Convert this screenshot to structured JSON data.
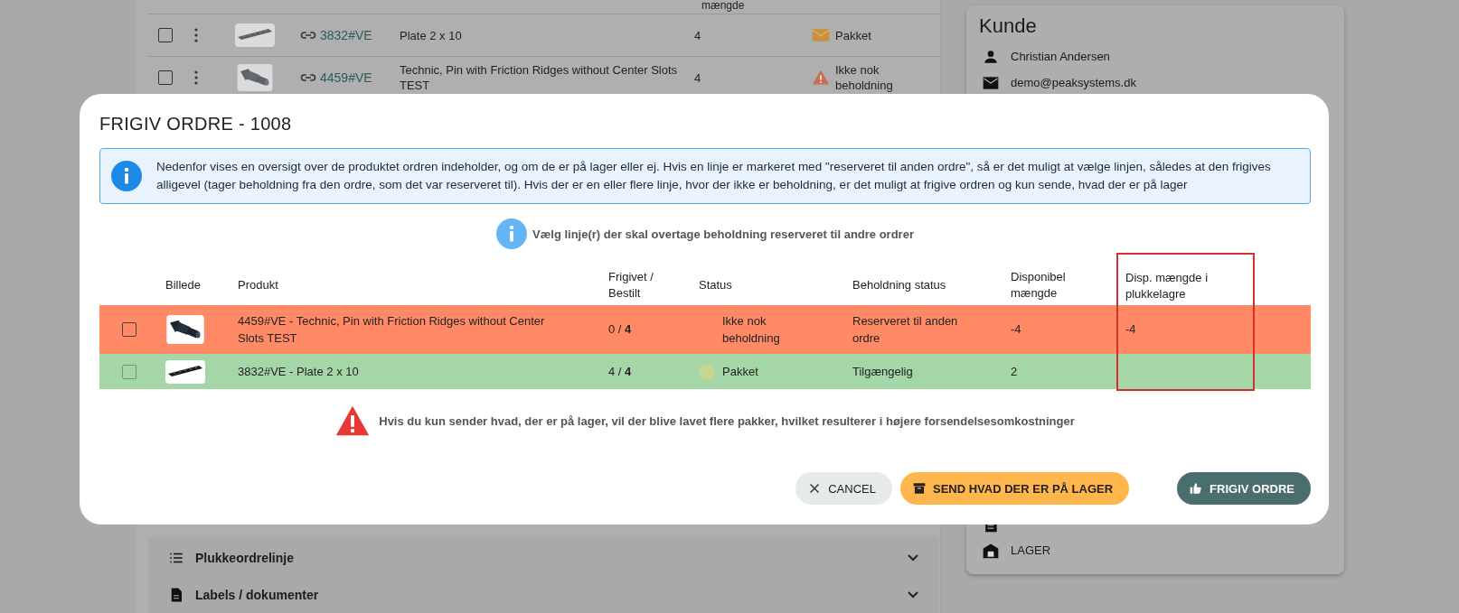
{
  "background": {
    "table": {
      "partial_header": "mængde",
      "rows": [
        {
          "checked": false,
          "link": "3832#VE",
          "product": "Plate 2 x 10",
          "quantity": "4",
          "status": "Pakket",
          "kind": "packed"
        },
        {
          "checked": false,
          "link": "4459#VE",
          "product": "Technic, Pin with Friction Ridges without Center Slots TEST",
          "quantity": "4",
          "status": "Ikke nok beholdning",
          "kind": "shortage"
        }
      ]
    },
    "accordions": [
      {
        "label": "Plukkeordrelinje",
        "expanded": false
      },
      {
        "label": "Labels / dokumenter",
        "expanded": false
      }
    ],
    "customer": {
      "title": "Kunde",
      "contact": [
        {
          "kind": "person",
          "text": "Christian Andersen"
        },
        {
          "kind": "email",
          "text": "demo@peaksystems.dk"
        }
      ],
      "details": [
        {
          "kind": "warehouse",
          "text": "LAGER"
        }
      ]
    }
  },
  "modal": {
    "title": "FRIGIV ORDRE - 1008",
    "info": "Nedenfor vises en oversigt over de produktet ordren indeholder, og om de er på lager eller ej. Hvis en linje er markeret med \"reserveret til anden ordre\", så er det muligt at vælge linjen, således at den frigives alligevel (tager beholdning fra den ordre, som det var reserveret til). Hvis der er en eller flere linje, hvor der ikke er beholdning, er det muligt at frigive ordren og kun sende, hvad der er på lager",
    "hint": "Vælg linje(r) der skal overtage beholdning reserveret til andre ordrer",
    "columns": [
      {
        "label": "Billede",
        "highlighted": false
      },
      {
        "label": "Produkt",
        "highlighted": false
      },
      {
        "label": "Frigivet / Bestilt",
        "highlighted": false
      },
      {
        "label": "Status",
        "highlighted": false
      },
      {
        "label": "Beholdning status",
        "highlighted": false
      },
      {
        "label": "Disponibel mængde",
        "highlighted": false
      },
      {
        "label": "Disp. mængde i plukkelagre",
        "highlighted": true
      }
    ],
    "rows": [
      {
        "checked": false,
        "disabled": false,
        "kind": "shortage",
        "product": "4459#VE - Technic, Pin with Friction Ridges without Center Slots TEST",
        "released": "0 / **4**",
        "status": "Ikke nok beholdning",
        "stock_status": "Reserveret til anden ordre",
        "available": "-4",
        "pick_available": "-4"
      },
      {
        "checked": false,
        "disabled": true,
        "kind": "available",
        "product": "3832#VE - Plate 2 x 10",
        "released": "4 / **4**",
        "status": "Pakket",
        "stock_status": "Tilgængelig",
        "available": "2"
      }
    ],
    "warning": "Hvis du kun sender hvad, der er på lager, vil der blive lavet flere pakker, hvilket resulterer i højere forsendelsesomkostninger",
    "buttons": [
      {
        "label": "CANCEL",
        "kind": "cancel"
      },
      {
        "label": "SEND HVAD DER ER PÅ LAGER",
        "kind": "partial"
      },
      {
        "label": "FRIGIV ORDRE",
        "kind": "release"
      }
    ]
  }
}
